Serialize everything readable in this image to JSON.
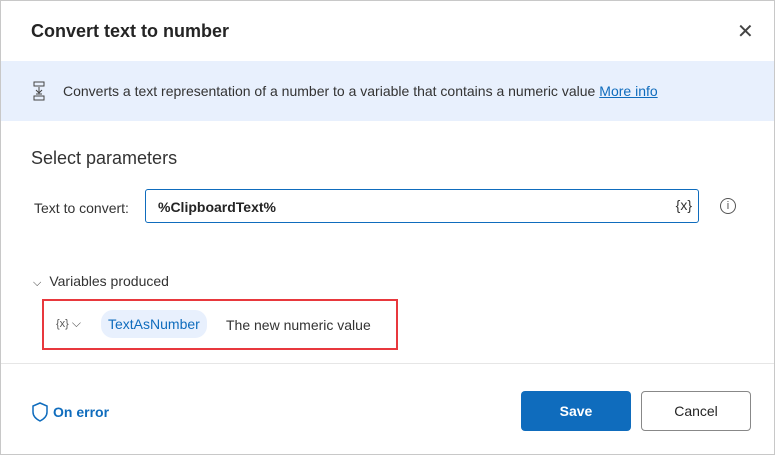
{
  "dialog": {
    "title": "Convert text to number",
    "close_icon": "close-icon"
  },
  "banner": {
    "text": "Converts a text representation of a number to a variable that contains a numeric value",
    "link": "More info"
  },
  "params": {
    "heading": "Select parameters",
    "text_label": "Text to convert:",
    "text_value": "%ClipboardText%",
    "var_button": "{x}",
    "info": "i"
  },
  "variables": {
    "heading": "Variables produced",
    "var_icon": "{x}",
    "name": "TextAsNumber",
    "description": "The new numeric value"
  },
  "footer": {
    "on_error": "On error",
    "save": "Save",
    "cancel": "Cancel"
  },
  "colors": {
    "accent": "#0f6cbd",
    "highlight": "#e8383d"
  }
}
